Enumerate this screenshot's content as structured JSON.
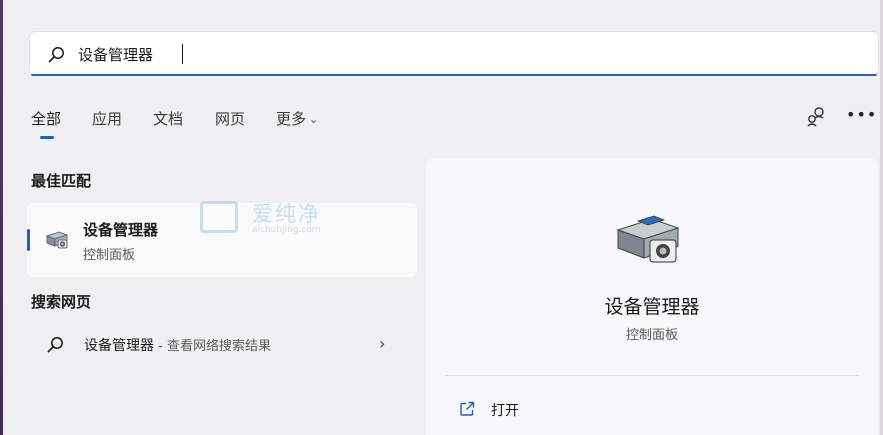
{
  "search": {
    "query": "设备管理器"
  },
  "tabs": [
    {
      "label": "全部"
    },
    {
      "label": "应用"
    },
    {
      "label": "文档"
    },
    {
      "label": "网页"
    },
    {
      "label": "更多"
    }
  ],
  "best_match": {
    "heading": "最佳匹配",
    "title": "设备管理器",
    "subtitle": "控制面板"
  },
  "watermark": {
    "brand": "爱纯净",
    "url": "aichunjing.com"
  },
  "web_search": {
    "heading": "搜索网页",
    "query": "设备管理器",
    "suffix": " - 查看网络搜索结果"
  },
  "detail": {
    "title": "设备管理器",
    "subtitle": "控制面板",
    "actions": [
      {
        "label": "打开"
      }
    ]
  },
  "colors": {
    "accent": "#1f5fbf",
    "background": "#f0f0f3"
  },
  "icons": {
    "search": "search-icon",
    "share": "share-icon",
    "more": "more-icon",
    "app": "device-manager-icon",
    "open": "open-external-icon"
  }
}
